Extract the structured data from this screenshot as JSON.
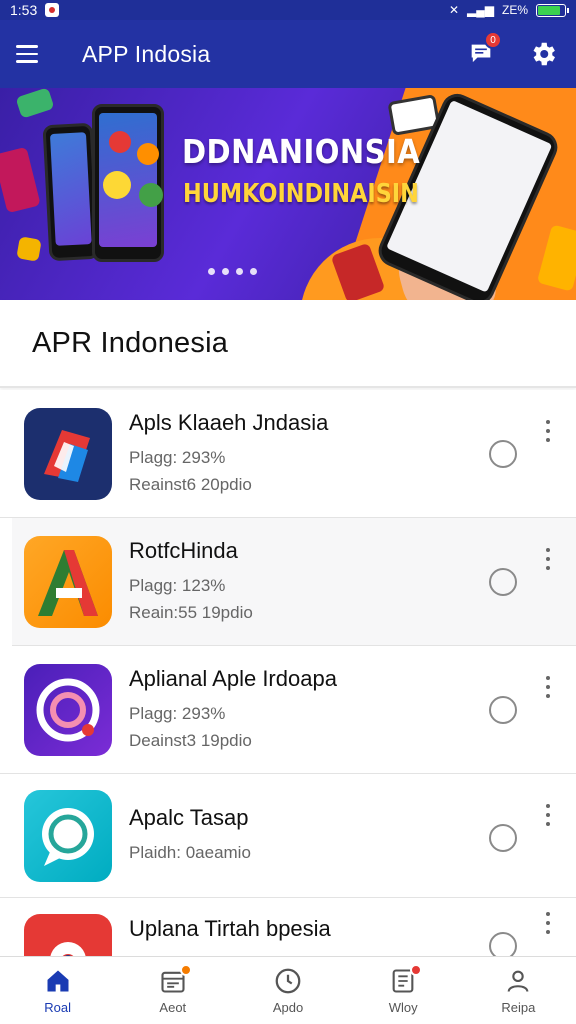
{
  "status_bar": {
    "time": "1:53",
    "battery_level": 0.85,
    "battery_text": "ZE%"
  },
  "app_bar": {
    "title": "APP Indosia",
    "chat_badge": "0",
    "menu_icon": "hamburger-menu-icon",
    "chat_icon": "chat-icon",
    "settings_icon": "gear-icon"
  },
  "banner": {
    "title": "DDNANIONSIA",
    "subtitle": "HUMKOINDINAISIN",
    "pages": 4,
    "accent_color": "#ffd53a"
  },
  "section": {
    "title": "APR Indonesia"
  },
  "apps": [
    {
      "title": "Apls Klaaeh Jndasia",
      "meta1": "Plagg: 293%",
      "meta2": "Reainst6 20pdio",
      "icon": "red-blue-square-icon"
    },
    {
      "title": "RotfcHinda",
      "meta1": "Plagg: 123%",
      "meta2": "Reain:55 19pdio",
      "icon": "letter-a-icon"
    },
    {
      "title": "Aplianal Aple Irdoapa",
      "meta1": "Plagg: 293%",
      "meta2": "Deainst3 19pdio",
      "icon": "purple-ring-icon"
    },
    {
      "title": "Apalc Tasap",
      "meta1": "",
      "meta2": "Plaidh: 0aeamio",
      "icon": "chat-bubble-icon"
    },
    {
      "title": "Uplana Tirtah bpesia",
      "meta1": "",
      "meta2": "",
      "icon": "red-arch-icon"
    }
  ],
  "bottom_nav": [
    {
      "label": "Roal",
      "icon": "home-icon",
      "active": true
    },
    {
      "label": "Aeot",
      "icon": "calendar-icon",
      "badge": true
    },
    {
      "label": "Apdo",
      "icon": "clock-icon"
    },
    {
      "label": "Wloy",
      "icon": "document-icon",
      "badge": true
    },
    {
      "label": "Reipa",
      "icon": "person-icon"
    }
  ]
}
